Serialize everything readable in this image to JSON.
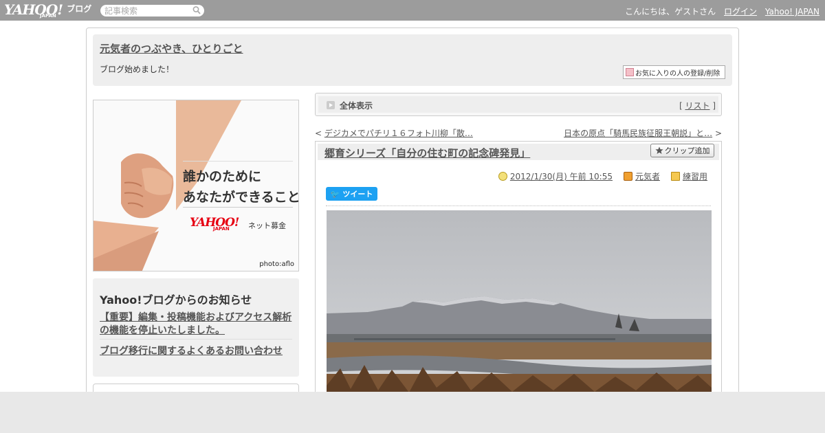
{
  "topbar": {
    "logo_text": "YAHOO!",
    "logo_sub": "JAPAN",
    "logo_blog": "ブログ",
    "search_placeholder": "記事検索",
    "greeting": "こんにちは、ゲストさん",
    "login": "ログイン",
    "yahoo_japan": "Yahoo! JAPAN"
  },
  "header": {
    "blog_title": "元気者のつぶやき、ひとりごと",
    "description": "ブログ始めました！",
    "fav_button": "お気に入りの人の登録/削除"
  },
  "ad": {
    "line1": "誰かのために",
    "line2": "あなたができること",
    "logo": "YAHOO!",
    "logo_sub": "JAPAN",
    "donation": "ネット募金",
    "credit": "photo:aflo"
  },
  "notice": {
    "heading": "Yahoo!ブログからのお知らせ",
    "items": [
      "【重要】編集・投稿機能およびアクセス解析の機能を停止いたしました。",
      "ブログ移行に関するよくあるお問い合わせ"
    ]
  },
  "listbar": {
    "label": "全体表示",
    "list_open": "[ ",
    "list_link": "リスト",
    "list_close": " ]"
  },
  "navigation": {
    "prev_marker": "< ",
    "prev": "デジカメでパチリ１６フォト川柳「散…",
    "next": "日本の原点「騎馬民族征服王朝説」と…",
    "next_marker": " >"
  },
  "article": {
    "title": "郷育シリーズ「自分の住む町の記念碑発見」",
    "clip_button": "クリップ追加",
    "datetime": "2012/1/30(月) 午前 10:55",
    "author": "元気者",
    "category": "練習用",
    "tweet": "ツイート"
  },
  "colors": {
    "topbar": "#9c9c9c",
    "tweet": "#1da1f2",
    "ad_logo": "#e60012"
  }
}
